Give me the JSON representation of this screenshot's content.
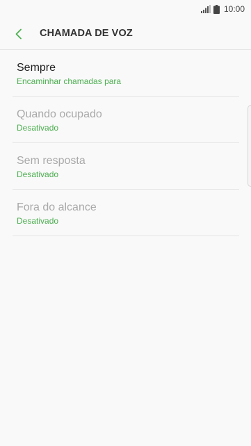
{
  "status_bar": {
    "time": "10:00",
    "icons": [
      "signal-icon",
      "battery-icon"
    ]
  },
  "header": {
    "title": "CHAMADA DE VOZ",
    "back_icon": "chevron-left-icon"
  },
  "colors": {
    "accent": "#4caf50",
    "text_primary": "#222222",
    "text_disabled": "#a9a9a9",
    "background": "#f9f9f9"
  },
  "list": {
    "items": [
      {
        "title": "Sempre",
        "subtitle": "Encaminhar chamadas para",
        "enabled": true
      },
      {
        "title": "Quando ocupado",
        "subtitle": "Desativado",
        "enabled": false
      },
      {
        "title": "Sem resposta",
        "subtitle": "Desativado",
        "enabled": false
      },
      {
        "title": "Fora do alcance",
        "subtitle": "Desativado",
        "enabled": false
      }
    ]
  }
}
